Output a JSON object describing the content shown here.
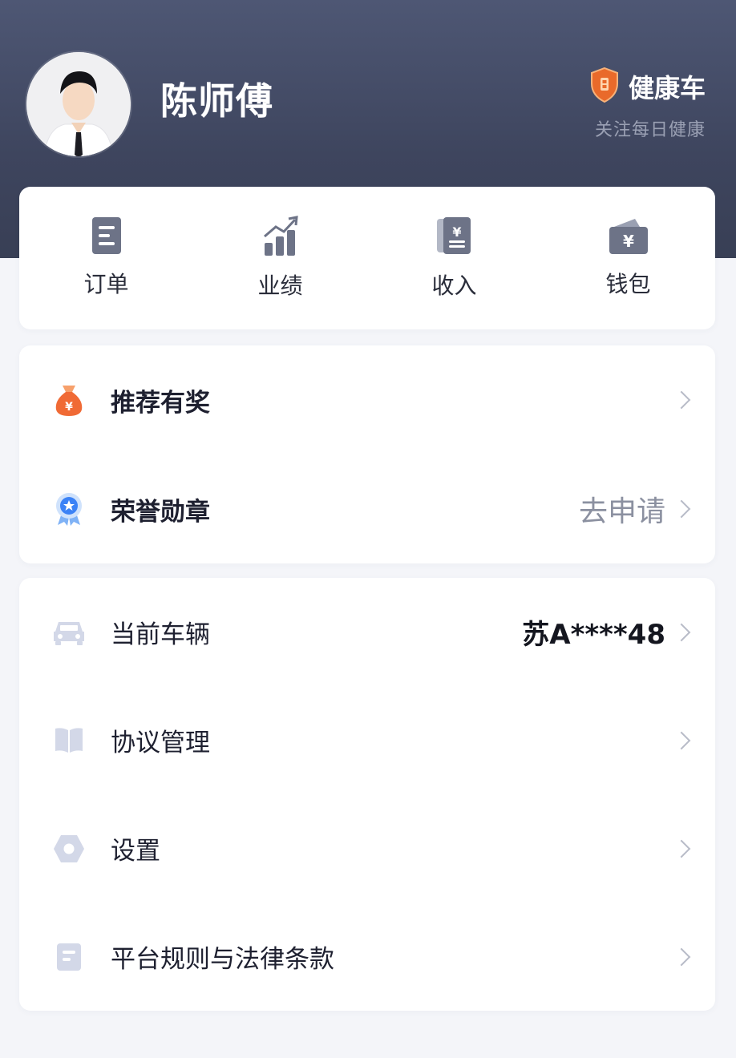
{
  "profile": {
    "name": "陈师傅",
    "health_title": "健康车",
    "health_subtitle": "关注每日健康"
  },
  "quick_actions": [
    {
      "label": "订单",
      "icon": "order-icon"
    },
    {
      "label": "业绩",
      "icon": "chart-icon"
    },
    {
      "label": "收入",
      "icon": "income-icon"
    },
    {
      "label": "钱包",
      "icon": "wallet-icon"
    }
  ],
  "menu_group_1": [
    {
      "label": "推荐有奖",
      "icon": "money-bag-icon",
      "value": ""
    },
    {
      "label": "荣誉勋章",
      "icon": "medal-icon",
      "value": "去申请"
    }
  ],
  "menu_group_2": [
    {
      "label": "当前车辆",
      "icon": "car-icon",
      "value": "苏A****48"
    },
    {
      "label": "协议管理",
      "icon": "book-icon",
      "value": ""
    },
    {
      "label": "设置",
      "icon": "settings-icon",
      "value": ""
    },
    {
      "label": "平台规则与法律条款",
      "icon": "document-icon",
      "value": ""
    }
  ],
  "colors": {
    "header": "#434b66",
    "accent_orange": "#f06a35",
    "icon_gray": "#6d7387",
    "icon_light": "#d3d8e8",
    "medal_blue": "#3b82f6"
  }
}
